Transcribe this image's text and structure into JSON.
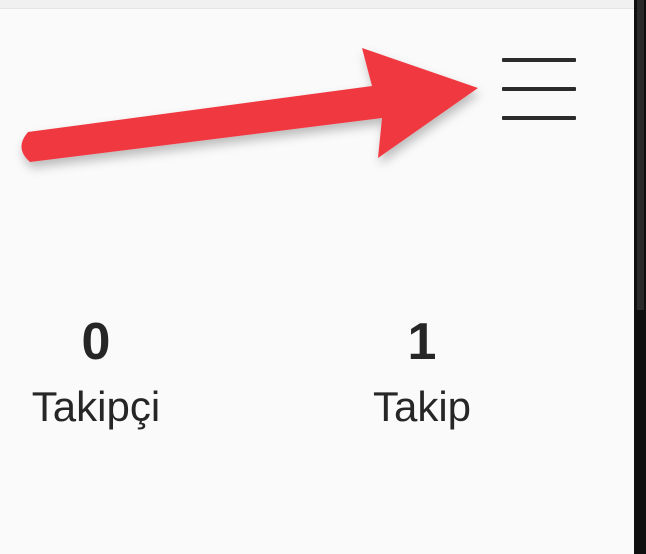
{
  "profile": {
    "menu_icon": "hamburger-menu-icon",
    "stats": [
      {
        "count": "0",
        "label": "Takipçi"
      },
      {
        "count": "1",
        "label": "Takip"
      }
    ]
  },
  "annotation": {
    "arrow_color": "#f0383f",
    "pointing_to": "hamburger-menu-icon"
  }
}
